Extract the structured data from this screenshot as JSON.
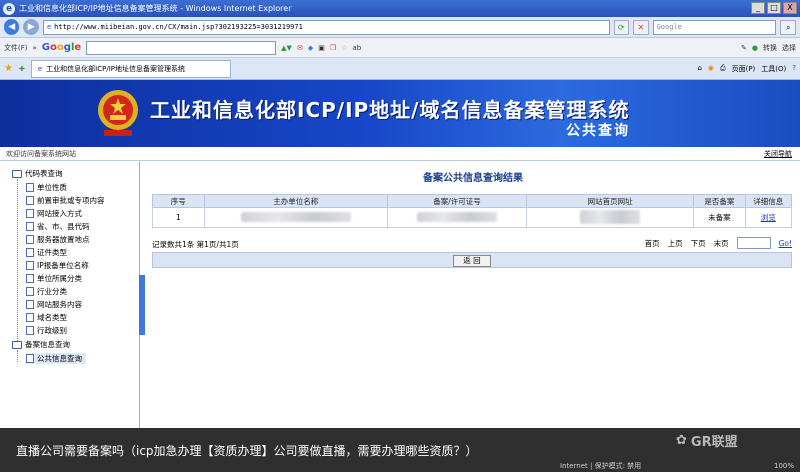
{
  "window": {
    "title": "工业和信息化部ICP/IP地址信息备案管理系统 - Windows Internet Explorer",
    "min": "_",
    "max": "□",
    "close": "X"
  },
  "addressbar": {
    "url": "http://www.miibeian.gov.cn/CX/main.jsp?302193225=3031219971",
    "search_placeholder": "Google"
  },
  "menubar": {
    "file_menu": "文件(F)",
    "chevron": "»",
    "google_label": "Google",
    "convert_label": "转换",
    "select_label": "选择"
  },
  "tabs": [
    {
      "label": "工业和信息化部ICP/IP地址信息备案管理系统"
    }
  ],
  "command_bar": {
    "page_menu": "页面(P)",
    "tools_menu": "工具(O)"
  },
  "banner": {
    "title": "工业和信息化部ICP/IP地址/域名信息备案管理系统",
    "subtitle": "公共查询"
  },
  "welcome": {
    "text": "欢迎访问备案系统网站",
    "close_nav": "关闭导航"
  },
  "sidebar": {
    "group1": "代码表查询",
    "items1": [
      "单位性质",
      "前置审批或专项内容",
      "网站接入方式",
      "省、市、县代码",
      "服务器放置地点",
      "证件类型",
      "IP报备单位名称",
      "单位所属分类",
      "行业分类",
      "网站服务内容",
      "域名类型",
      "行政级别"
    ],
    "group2": "备案信息查询",
    "items2": [
      "公共信息查询"
    ]
  },
  "main": {
    "result_title": "备案公共信息查询结果",
    "table": {
      "headers": [
        "序号",
        "主办单位名称",
        "备案/许可证号",
        "网站首页网址",
        "是否备案",
        "详细信息"
      ],
      "rows": [
        {
          "index": "1",
          "status": "未备案",
          "detail": "浏览"
        }
      ]
    },
    "pager": {
      "summary": "记录数共1条 第1页/共1页",
      "first": "首页",
      "prev": "上页",
      "next": "下页",
      "last": "末页",
      "go": "Go!"
    },
    "back_button": "返 回"
  },
  "caption": {
    "text": "直播公司需要备案吗（icp加急办理【资质办理】公司要做直播，需要办理哪些资质？）",
    "watermark": "GR联盟"
  },
  "statusbar": {
    "zone": "Internet | 保护模式: 禁用",
    "zoom": "100%"
  }
}
